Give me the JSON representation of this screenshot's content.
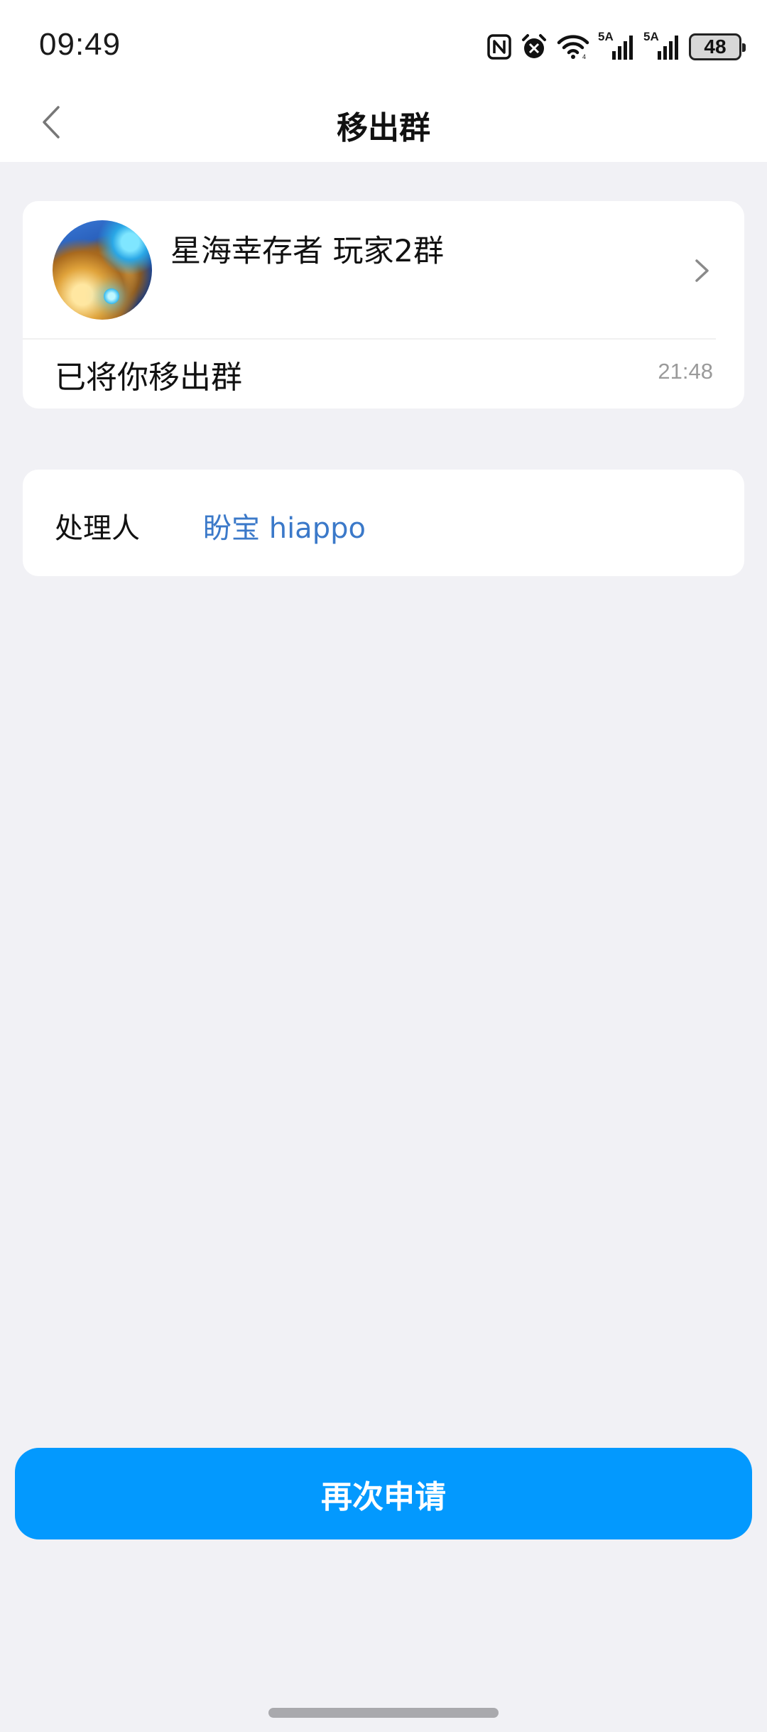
{
  "status_bar": {
    "time": "09:49",
    "icons": [
      "nfc-icon",
      "alarm-icon",
      "wifi-icon",
      "signal-5a-icon",
      "signal-5a-icon"
    ],
    "signal_1_label": "5A",
    "signal_2_label": "5A",
    "battery_level": "48"
  },
  "nav": {
    "back_icon": "chevron-left-icon",
    "title": "移出群"
  },
  "group_card": {
    "group_name": "星海幸存者 玩家2群",
    "notice": "已将你移出群",
    "time": "21:48",
    "chevron_icon": "chevron-right-icon"
  },
  "handler_card": {
    "label": "处理人",
    "name": "盼宝 hiappo"
  },
  "action": {
    "reapply_label": "再次申请"
  },
  "colors": {
    "background": "#f1f1f5",
    "card": "#ffffff",
    "primary_button": "#0399fe",
    "link": "#3b79c9",
    "secondary_text": "#9a9a9a"
  }
}
